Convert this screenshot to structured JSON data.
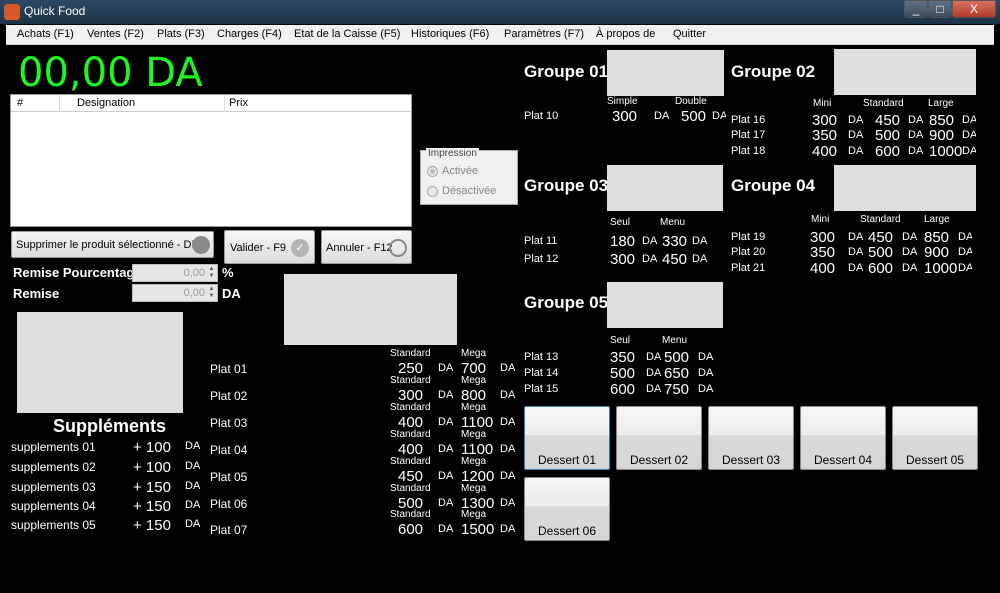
{
  "window": {
    "title": "Quick Food",
    "min": "_",
    "max": "□",
    "close": "X"
  },
  "menu": [
    "Achats (F1)",
    "Ventes (F2)",
    "Plats (F3)",
    "Charges (F4)",
    "Etat de la Caisse (F5)",
    "Historiques (F6)",
    "Paramètres (F7)",
    "À propos de",
    "Quitter"
  ],
  "total": "00,00 DA",
  "order_table": {
    "columns": [
      "#",
      "Designation",
      "Prix"
    ]
  },
  "buttons": {
    "delete": "Supprimer le produit sélectionné - DEL",
    "validate": "Valider - F9",
    "cancel": "Annuler - F12"
  },
  "impression": {
    "legend": "Impression",
    "options": [
      "Activée",
      "Désactivée"
    ],
    "selected": "Activée"
  },
  "remise": {
    "percent_label": "Remise Pourcentag",
    "percent_value": "0,00",
    "percent_unit": "%",
    "amount_label": "Remise",
    "amount_value": "0,00",
    "amount_unit": "DA"
  },
  "supplements": {
    "title": "Suppléments",
    "items": [
      {
        "name": "supplements 01",
        "price": "+ 100",
        "unit": "DA"
      },
      {
        "name": "supplements 02",
        "price": "+ 100",
        "unit": "DA"
      },
      {
        "name": "supplements 03",
        "price": "+ 150",
        "unit": "DA"
      },
      {
        "name": "supplements 04",
        "price": "+ 150",
        "unit": "DA"
      },
      {
        "name": "supplements 05",
        "price": "+ 150",
        "unit": "DA"
      }
    ]
  },
  "plats_main": {
    "size_labels": [
      "Standard",
      "Mega"
    ],
    "unit": "DA",
    "items": [
      {
        "name": "Plat 01",
        "p1": "250",
        "p2": "700"
      },
      {
        "name": "Plat 02",
        "p1": "300",
        "p2": "800"
      },
      {
        "name": "Plat 03",
        "p1": "400",
        "p2": "1100"
      },
      {
        "name": "Plat 04",
        "p1": "400",
        "p2": "1100"
      },
      {
        "name": "Plat 05",
        "p1": "450",
        "p2": "1200"
      },
      {
        "name": "Plat 06",
        "p1": "500",
        "p2": "1300"
      },
      {
        "name": "Plat 07",
        "p1": "600",
        "p2": "1500"
      }
    ]
  },
  "groups": {
    "g1": {
      "title": "Groupe 01",
      "sizes": [
        "Simple",
        "Double"
      ],
      "items": [
        {
          "name": "Plat 10",
          "p1": "300",
          "p2": "500"
        }
      ]
    },
    "g2": {
      "title": "Groupe 02",
      "sizes": [
        "Mini",
        "Standard",
        "Large"
      ],
      "items": [
        {
          "name": "Plat 16",
          "p1": "300",
          "p2": "450",
          "p3": "850"
        },
        {
          "name": "Plat 17",
          "p1": "350",
          "p2": "500",
          "p3": "900"
        },
        {
          "name": "Plat 18",
          "p1": "400",
          "p2": "600",
          "p3": "1000"
        }
      ]
    },
    "g3": {
      "title": "Groupe 03",
      "sizes": [
        "Seul",
        "Menu"
      ],
      "items": [
        {
          "name": "Plat 11",
          "p1": "180",
          "p2": "330"
        },
        {
          "name": "Plat 12",
          "p1": "300",
          "p2": "450"
        }
      ]
    },
    "g4": {
      "title": "Groupe 04",
      "sizes": [
        "Mini",
        "Standard",
        "Large"
      ],
      "items": [
        {
          "name": "Plat 19",
          "p1": "300",
          "p2": "450",
          "p3": "850"
        },
        {
          "name": "Plat 20",
          "p1": "350",
          "p2": "500",
          "p3": "900"
        },
        {
          "name": "Plat 21",
          "p1": "400",
          "p2": "600",
          "p3": "1000"
        }
      ]
    },
    "g5": {
      "title": "Groupe 05",
      "sizes": [
        "Seul",
        "Menu"
      ],
      "items": [
        {
          "name": "Plat 13",
          "p1": "350",
          "p2": "500"
        },
        {
          "name": "Plat 14",
          "p1": "500",
          "p2": "650"
        },
        {
          "name": "Plat 15",
          "p1": "600",
          "p2": "750"
        }
      ]
    },
    "unit": "DA"
  },
  "desserts": [
    "Dessert 01",
    "Dessert 02",
    "Dessert 03",
    "Dessert 04",
    "Dessert 05",
    "Dessert 06"
  ]
}
